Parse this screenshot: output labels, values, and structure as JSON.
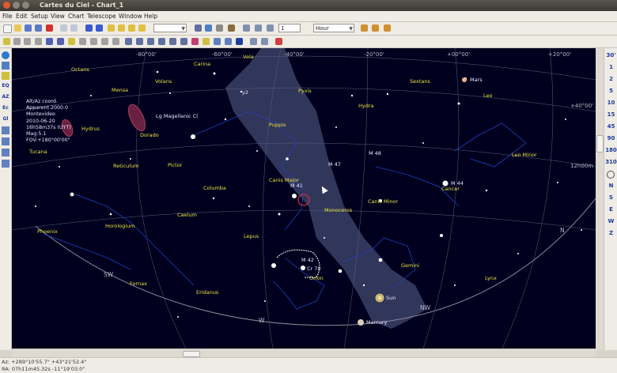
{
  "window": {
    "title": "Cartes du Ciel - Chart_1"
  },
  "menu": [
    "File",
    "Edit",
    "Setup",
    "View",
    "Chart",
    "Telescope",
    "Window",
    "Help"
  ],
  "toolbar": {
    "field_value": "1",
    "time_unit": "Hour"
  },
  "chart_info": {
    "coord": "Alt/Az coord.",
    "equinox": "Apparent 2000.0",
    "location": "Montevideo",
    "date": "2010-06-20",
    "time": "16h58m37s (UYT)",
    "mag": "Mag:5.1",
    "fov": "FOV:+180°00'00\""
  },
  "grid_labels": {
    "top": [
      "-80°00'",
      "-60°00'",
      "-40°00'",
      "-20°00'",
      "+00°00'",
      "+20°00'"
    ],
    "right_dec": "+40°00'",
    "ra_right": "12h00m"
  },
  "horizon": [
    "SW",
    "W",
    "NW",
    "N"
  ],
  "constellations": [
    "Octans",
    "Carina",
    "Vela",
    "Mensa",
    "Volans",
    "Hydrus",
    "Dorado",
    "Pyxis",
    "Hydra",
    "Sextans",
    "Leo",
    "Puppis",
    "Tucana",
    "Reticulum",
    "Pictor",
    "Columba",
    "Canis Major",
    "Monoceros",
    "Canis Minor",
    "Cancer",
    "Leo Minor",
    "Horologium",
    "Caelum",
    "Phoenix",
    "Lepus",
    "Orion",
    "Gemini",
    "Fornax",
    "Eridanus",
    "Lynx"
  ],
  "objects": {
    "lmc": "Lg Magellanic Cl",
    "planets": [
      "Mars",
      "Sun",
      "Mercury"
    ],
    "messier": [
      "M 48",
      "M 47",
      "M 41",
      "M 44",
      "M 42"
    ],
    "others": [
      "Cr 70",
      "y2"
    ]
  },
  "left_toolbar": [
    "EQ",
    "AZ",
    "Ec",
    "Gl"
  ],
  "right_toolbar": {
    "fov": [
      "30'",
      "1",
      "2",
      "5",
      "10",
      "15",
      "45",
      "90",
      "180",
      "310"
    ],
    "directions": [
      "N",
      "S",
      "E",
      "W",
      "Z"
    ]
  },
  "status": {
    "line1": "Az: +289°10'55.7\" +43°21'52.4\"",
    "line2": "RA: 07h11m45.32s -11°19'03.0\""
  }
}
